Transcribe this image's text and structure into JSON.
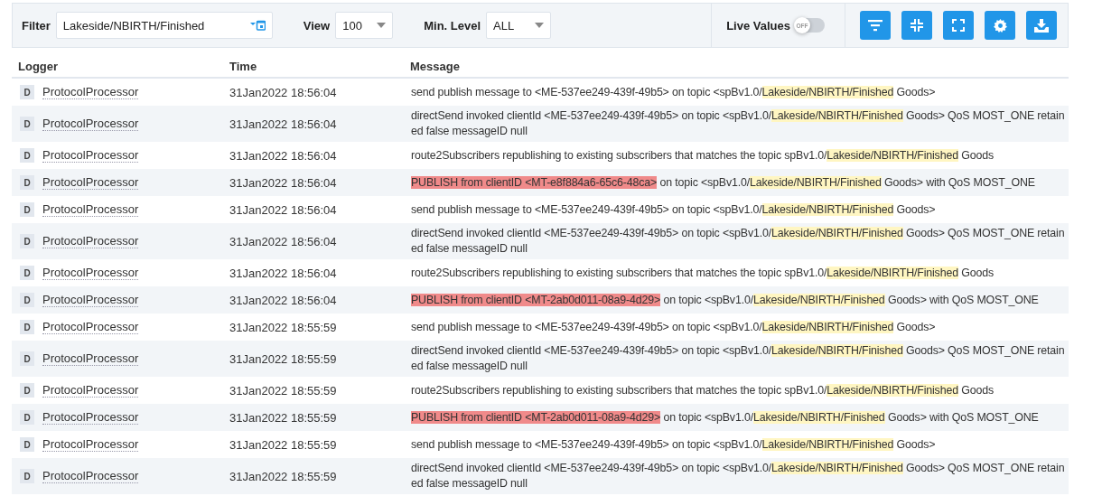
{
  "toolbar": {
    "filter": {
      "label": "Filter",
      "value": "Lakeside/NBIRTH/Finished"
    },
    "view": {
      "label": "View",
      "value": "100"
    },
    "min_level": {
      "label": "Min. Level",
      "value": "ALL"
    },
    "live_values": {
      "label": "Live Values",
      "on": false,
      "knob_text": "OFF"
    },
    "buttons": [
      {
        "kind": "filter"
      },
      {
        "kind": "collapse"
      },
      {
        "kind": "expand"
      },
      {
        "kind": "settings"
      },
      {
        "kind": "download"
      }
    ]
  },
  "table": {
    "columns": [
      "Logger",
      "Time",
      "Message"
    ],
    "rows": [
      {
        "level": "D",
        "logger": "ProtocolProcessor",
        "time": "31Jan2022 18:56:04",
        "parts": [
          {
            "kind": "plain",
            "text": "send publish message to <ME-537ee249-439f-49b5> on topic <spBv1.0/"
          },
          {
            "kind": "match",
            "text": "Lakeside/NBIRTH/Finished"
          },
          {
            "kind": "plain",
            "text": " Goods>"
          }
        ]
      },
      {
        "level": "D",
        "logger": "ProtocolProcessor",
        "time": "31Jan2022 18:56:04",
        "parts": [
          {
            "kind": "plain",
            "text": "directSend invoked clientId <ME-537ee249-439f-49b5> on topic <spBv1.0/"
          },
          {
            "kind": "match",
            "text": "Lakeside/NBIRTH/Finished"
          },
          {
            "kind": "plain",
            "text": " Goods> QoS MOST_ONE retained false messageID null"
          }
        ]
      },
      {
        "level": "D",
        "logger": "ProtocolProcessor",
        "time": "31Jan2022 18:56:04",
        "parts": [
          {
            "kind": "plain",
            "text": "route2Subscribers republishing to existing subscribers that matches the topic spBv1.0/"
          },
          {
            "kind": "match",
            "text": "Lakeside/NBIRTH/Finished"
          },
          {
            "kind": "plain",
            "text": " Goods"
          }
        ]
      },
      {
        "level": "D",
        "logger": "ProtocolProcessor",
        "time": "31Jan2022 18:56:04",
        "parts": [
          {
            "kind": "alert",
            "text": "PUBLISH from clientID <MT-e8f884a6-65c6-48ca>"
          },
          {
            "kind": "plain",
            "text": " on topic <spBv1.0/"
          },
          {
            "kind": "match",
            "text": "Lakeside/NBIRTH/Finished"
          },
          {
            "kind": "plain",
            "text": " Goods> with QoS MOST_ONE"
          }
        ]
      },
      {
        "level": "D",
        "logger": "ProtocolProcessor",
        "time": "31Jan2022 18:56:04",
        "parts": [
          {
            "kind": "plain",
            "text": "send publish message to <ME-537ee249-439f-49b5> on topic <spBv1.0/"
          },
          {
            "kind": "match",
            "text": "Lakeside/NBIRTH/Finished"
          },
          {
            "kind": "plain",
            "text": " Goods>"
          }
        ]
      },
      {
        "level": "D",
        "logger": "ProtocolProcessor",
        "time": "31Jan2022 18:56:04",
        "parts": [
          {
            "kind": "plain",
            "text": "directSend invoked clientId <ME-537ee249-439f-49b5> on topic <spBv1.0/"
          },
          {
            "kind": "match",
            "text": "Lakeside/NBIRTH/Finished"
          },
          {
            "kind": "plain",
            "text": " Goods> QoS MOST_ONE retained false messageID null"
          }
        ]
      },
      {
        "level": "D",
        "logger": "ProtocolProcessor",
        "time": "31Jan2022 18:56:04",
        "parts": [
          {
            "kind": "plain",
            "text": "route2Subscribers republishing to existing subscribers that matches the topic spBv1.0/"
          },
          {
            "kind": "match",
            "text": "Lakeside/NBIRTH/Finished"
          },
          {
            "kind": "plain",
            "text": " Goods"
          }
        ]
      },
      {
        "level": "D",
        "logger": "ProtocolProcessor",
        "time": "31Jan2022 18:56:04",
        "parts": [
          {
            "kind": "alert",
            "text": "PUBLISH from clientID <MT-2ab0d011-08a9-4d29>"
          },
          {
            "kind": "plain",
            "text": " on topic <spBv1.0/"
          },
          {
            "kind": "match",
            "text": "Lakeside/NBIRTH/Finished"
          },
          {
            "kind": "plain",
            "text": " Goods> with QoS MOST_ONE"
          }
        ]
      },
      {
        "level": "D",
        "logger": "ProtocolProcessor",
        "time": "31Jan2022 18:55:59",
        "parts": [
          {
            "kind": "plain",
            "text": "send publish message to <ME-537ee249-439f-49b5> on topic <spBv1.0/"
          },
          {
            "kind": "match",
            "text": "Lakeside/NBIRTH/Finished"
          },
          {
            "kind": "plain",
            "text": " Goods>"
          }
        ]
      },
      {
        "level": "D",
        "logger": "ProtocolProcessor",
        "time": "31Jan2022 18:55:59",
        "parts": [
          {
            "kind": "plain",
            "text": "directSend invoked clientId <ME-537ee249-439f-49b5> on topic <spBv1.0/"
          },
          {
            "kind": "match",
            "text": "Lakeside/NBIRTH/Finished"
          },
          {
            "kind": "plain",
            "text": " Goods> QoS MOST_ONE retained false messageID null"
          }
        ]
      },
      {
        "level": "D",
        "logger": "ProtocolProcessor",
        "time": "31Jan2022 18:55:59",
        "parts": [
          {
            "kind": "plain",
            "text": "route2Subscribers republishing to existing subscribers that matches the topic spBv1.0/"
          },
          {
            "kind": "match",
            "text": "Lakeside/NBIRTH/Finished"
          },
          {
            "kind": "plain",
            "text": " Goods"
          }
        ]
      },
      {
        "level": "D",
        "logger": "ProtocolProcessor",
        "time": "31Jan2022 18:55:59",
        "parts": [
          {
            "kind": "alert",
            "text": "PUBLISH from clientID <MT-2ab0d011-08a9-4d29>"
          },
          {
            "kind": "plain",
            "text": " on topic <spBv1.0/"
          },
          {
            "kind": "match",
            "text": "Lakeside/NBIRTH/Finished"
          },
          {
            "kind": "plain",
            "text": " Goods> with QoS MOST_ONE"
          }
        ]
      },
      {
        "level": "D",
        "logger": "ProtocolProcessor",
        "time": "31Jan2022 18:55:59",
        "parts": [
          {
            "kind": "plain",
            "text": "send publish message to <ME-537ee249-439f-49b5> on topic <spBv1.0/"
          },
          {
            "kind": "match",
            "text": "Lakeside/NBIRTH/Finished"
          },
          {
            "kind": "plain",
            "text": " Goods>"
          }
        ]
      },
      {
        "level": "D",
        "logger": "ProtocolProcessor",
        "time": "31Jan2022 18:55:59",
        "parts": [
          {
            "kind": "plain",
            "text": "directSend invoked clientId <ME-537ee249-439f-49b5> on topic <spBv1.0/"
          },
          {
            "kind": "match",
            "text": "Lakeside/NBIRTH/Finished"
          },
          {
            "kind": "plain",
            "text": " Goods> QoS MOST_ONE retained false messageID null"
          }
        ]
      }
    ]
  }
}
